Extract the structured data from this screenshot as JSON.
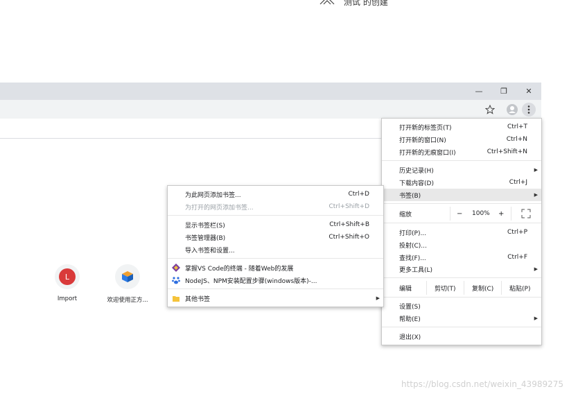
{
  "top_strip": {
    "text": "测试 的创建"
  },
  "window": {
    "minimize_glyph": "—",
    "restore_glyph": "❐",
    "close_glyph": "✕"
  },
  "shortcuts": [
    {
      "letter": "L",
      "label": "Import",
      "color": "#d93a3a"
    },
    {
      "letter": "",
      "label": "欢迎使用正方...",
      "color": "#2c7be5"
    }
  ],
  "chrome_menu": {
    "items": [
      {
        "label": "打开新的标签页(T)",
        "shortcut": "Ctrl+T"
      },
      {
        "label": "打开新的窗口(N)",
        "shortcut": "Ctrl+N"
      },
      {
        "label": "打开新的无痕窗口(I)",
        "shortcut": "Ctrl+Shift+N"
      },
      {
        "label": "历史记录(H)",
        "shortcut": ""
      },
      {
        "label": "下载内容(D)",
        "shortcut": "Ctrl+J"
      },
      {
        "label": "书签(B)",
        "shortcut": ""
      },
      {
        "label": "打印(P)...",
        "shortcut": "Ctrl+P"
      },
      {
        "label": "投射(C)...",
        "shortcut": ""
      },
      {
        "label": "查找(F)...",
        "shortcut": "Ctrl+F"
      },
      {
        "label": "更多工具(L)",
        "shortcut": ""
      },
      {
        "label": "设置(S)",
        "shortcut": ""
      },
      {
        "label": "帮助(E)",
        "shortcut": ""
      },
      {
        "label": "退出(X)",
        "shortcut": ""
      }
    ],
    "zoom": {
      "label": "缩放",
      "minus": "−",
      "value": "100%",
      "plus": "+"
    },
    "edit": {
      "label": "编辑",
      "cut": "剪切(T)",
      "copy": "复制(C)",
      "paste": "粘贴(P)"
    }
  },
  "bookmark_menu": {
    "items": [
      {
        "label": "为此网页添加书签...",
        "shortcut": "Ctrl+D"
      },
      {
        "label": "为打开的网页添加书签...",
        "shortcut": "Ctrl+Shift+D"
      },
      {
        "label": "显示书签栏(S)",
        "shortcut": "Ctrl+Shift+B"
      },
      {
        "label": "书签管理器(B)",
        "shortcut": "Ctrl+Shift+O"
      },
      {
        "label": "导入书签和设置...",
        "shortcut": ""
      },
      {
        "label": "掌握VS Code的终端 - 随着Web的发展",
        "shortcut": ""
      },
      {
        "label": "NodeJS、NPM安装配置步骤(windows版本)-...",
        "shortcut": ""
      },
      {
        "label": "其他书签",
        "shortcut": ""
      }
    ]
  },
  "watermark": "https://blog.csdn.net/weixin_43989275"
}
